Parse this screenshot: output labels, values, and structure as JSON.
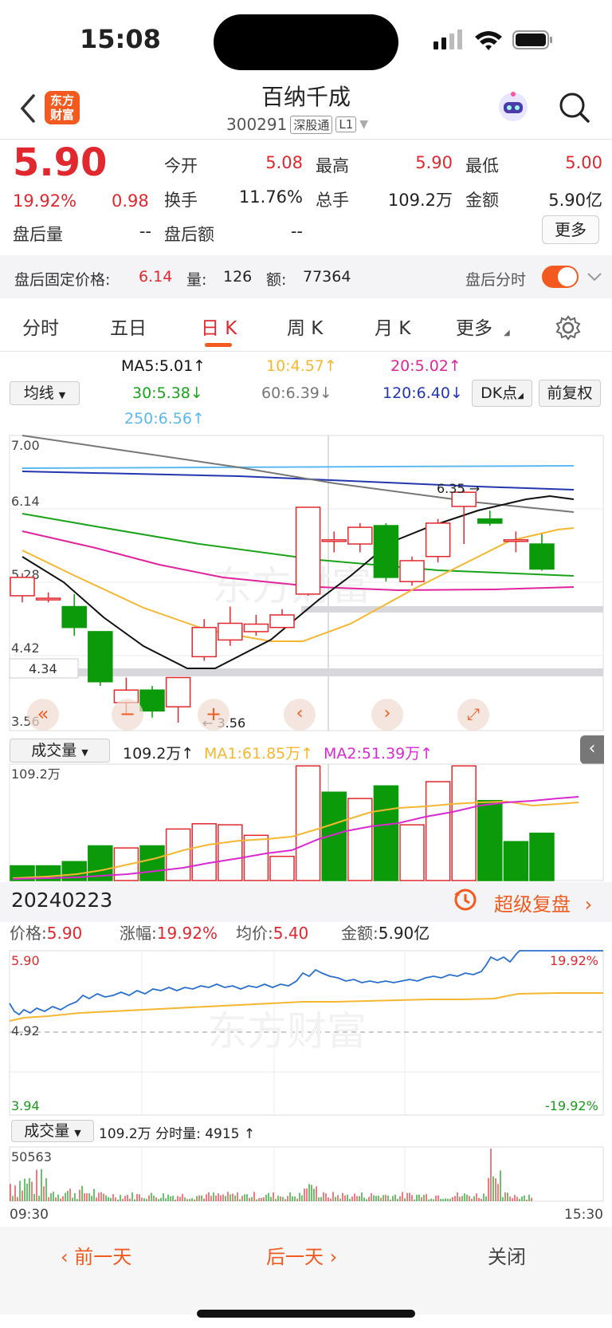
{
  "status": {
    "time": "15:08"
  },
  "header": {
    "title": "百纳千成",
    "code": "300291",
    "tag1": "深股通",
    "tag2": "L1",
    "logo_line1": "东方",
    "logo_line2": "财富"
  },
  "quote": {
    "price": "5.90",
    "pct": "19.92%",
    "change": "0.98",
    "open_label": "今开",
    "open": "5.08",
    "high_label": "最高",
    "high": "5.90",
    "low_label": "最低",
    "low": "5.00",
    "turnover_label": "换手",
    "turnover": "11.76%",
    "vol_label": "总手",
    "vol": "109.2万",
    "amount_label": "金额",
    "amount": "5.90亿",
    "after_vol_label": "盘后量",
    "after_vol": "--",
    "after_amt_label": "盘后额",
    "after_amt": "--",
    "more": "更多"
  },
  "after": {
    "label": "盘后固定价格:",
    "price": "6.14",
    "qty_label": "量:",
    "qty": "126",
    "amt_label": "额:",
    "amt": "77364",
    "toggle_label": "盘后分时"
  },
  "tabs": [
    "分时",
    "五日",
    "日 K",
    "周 K",
    "月 K",
    "更多"
  ],
  "ma": {
    "select": "均线",
    "ma5": "MA5:5.01↑",
    "ma10": "10:4.57↑",
    "ma20": "20:5.02↑",
    "ma30": "30:5.38↓",
    "ma60": "60:6.39↓",
    "ma120": "120:6.40↓",
    "ma250": "250:6.56↑",
    "dk": "DK点",
    "fq": "前复权"
  },
  "kline": {
    "y_labels": [
      "7.00",
      "6.14",
      "5.28",
      "4.42",
      "3.56"
    ],
    "cross_value": "4.34",
    "max_label": "6.35",
    "min_label": "3.56",
    "candles": [
      {
        "o": 5.08,
        "c": 5.3,
        "h": 5.35,
        "l": 5.0
      },
      {
        "o": 5.05,
        "c": 5.05,
        "h": 5.12,
        "l": 5.0
      },
      {
        "o": 4.95,
        "c": 4.7,
        "h": 5.1,
        "l": 4.6
      },
      {
        "o": 4.65,
        "c": 4.05,
        "h": 4.65,
        "l": 4.0
      },
      {
        "o": 3.8,
        "c": 3.95,
        "h": 4.1,
        "l": 3.65
      },
      {
        "o": 3.95,
        "c": 3.7,
        "h": 4.0,
        "l": 3.62
      },
      {
        "o": 3.75,
        "c": 4.1,
        "h": 4.1,
        "l": 3.56
      },
      {
        "o": 4.35,
        "c": 4.7,
        "h": 4.8,
        "l": 4.3
      },
      {
        "o": 4.55,
        "c": 4.75,
        "h": 4.95,
        "l": 4.48
      },
      {
        "o": 4.65,
        "c": 4.74,
        "h": 4.85,
        "l": 4.6
      },
      {
        "o": 4.7,
        "c": 4.85,
        "h": 4.92,
        "l": 4.7
      },
      {
        "o": 5.1,
        "c": 6.14,
        "h": 6.14,
        "l": 5.08
      },
      {
        "o": 5.75,
        "c": 5.75,
        "h": 5.85,
        "l": 5.6
      },
      {
        "o": 5.7,
        "c": 5.9,
        "h": 5.95,
        "l": 5.6
      },
      {
        "o": 5.92,
        "c": 5.3,
        "h": 5.95,
        "l": 5.25
      },
      {
        "o": 5.25,
        "c": 5.5,
        "h": 5.55,
        "l": 5.2
      },
      {
        "o": 5.55,
        "c": 5.95,
        "h": 6.0,
        "l": 5.48
      },
      {
        "o": 6.15,
        "c": 6.32,
        "h": 6.35,
        "l": 5.7
      },
      {
        "o": 6.0,
        "c": 5.95,
        "h": 6.1,
        "l": 5.92
      },
      {
        "o": 5.75,
        "c": 5.75,
        "h": 5.85,
        "l": 5.6
      },
      {
        "o": 5.7,
        "c": 5.4,
        "h": 5.82,
        "l": 5.38
      }
    ]
  },
  "volume": {
    "select": "成交量",
    "value": "109.2万↑",
    "ma1": "MA1:61.85万↑",
    "ma2": "MA2:51.39万↑",
    "max_label": "109.2万",
    "bars": [
      {
        "v": 14,
        "up": false
      },
      {
        "v": 14,
        "up": false
      },
      {
        "v": 18,
        "up": false
      },
      {
        "v": 33,
        "up": false
      },
      {
        "v": 31,
        "up": true
      },
      {
        "v": 33,
        "up": false
      },
      {
        "v": 49,
        "up": true
      },
      {
        "v": 54,
        "up": true
      },
      {
        "v": 53,
        "up": true
      },
      {
        "v": 43,
        "up": true
      },
      {
        "v": 23,
        "up": true
      },
      {
        "v": 109,
        "up": true
      },
      {
        "v": 84,
        "up": false
      },
      {
        "v": 78,
        "up": true
      },
      {
        "v": 90,
        "up": false
      },
      {
        "v": 53,
        "up": true
      },
      {
        "v": 94,
        "up": true
      },
      {
        "v": 109,
        "up": true
      },
      {
        "v": 76,
        "up": false
      },
      {
        "v": 37,
        "up": false
      },
      {
        "v": 45,
        "up": false
      }
    ]
  },
  "day": {
    "date": "20240223",
    "replay": "超级复盘",
    "price_label": "价格:",
    "price": "5.90",
    "pct_label": "涨幅:",
    "pct": "19.92%",
    "avg_label": "均价:",
    "avg": "5.40",
    "amt_label": "金额:",
    "amt": "5.90亿",
    "y_top": "5.90",
    "y_mid": "4.92",
    "y_bot": "3.94",
    "pct_top": "19.92%",
    "pct_bot": "-19.92%",
    "vol_select": "成交量",
    "vol_text": "109.2万 分时量: 4915 ↑",
    "vol_max": "50563",
    "t_start": "09:30",
    "t_end": "15:30"
  },
  "footer": {
    "prev": "前一天",
    "next": "后一天",
    "close": "关闭"
  },
  "colors": {
    "up": "#e0282e",
    "down": "#0a9a0a",
    "accent": "#f25a1f",
    "ma5": "#111111",
    "ma10": "#f5b731",
    "ma20": "#e0259c",
    "ma30": "#1aa31a",
    "ma60": "#777777",
    "ma120": "#2336b0",
    "ma250": "#5bb8f0"
  }
}
